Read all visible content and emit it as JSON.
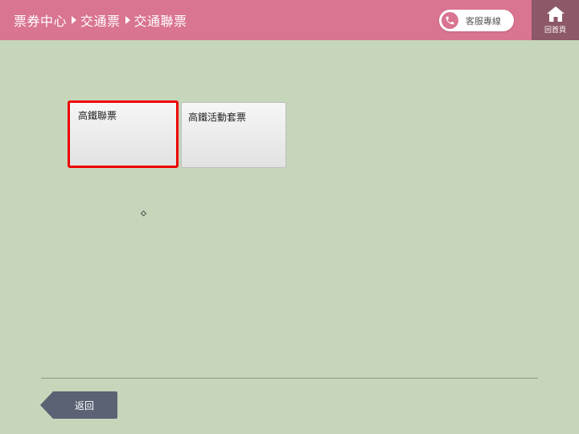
{
  "header": {
    "breadcrumb": [
      "票券中心",
      "交通票",
      "交通聯票"
    ],
    "support_label": "客服專線",
    "home_label": "回首頁"
  },
  "tiles": [
    {
      "label": "高鐵聯票",
      "selected": true
    },
    {
      "label": "高鐵活動套票",
      "selected": false
    }
  ],
  "footer": {
    "back_label": "返回"
  },
  "colors": {
    "header_bg": "#d97491",
    "home_bg": "#8d5868",
    "page_bg": "#c5d6bb",
    "selection_border": "#ee0000",
    "back_button": "#5a6273"
  }
}
